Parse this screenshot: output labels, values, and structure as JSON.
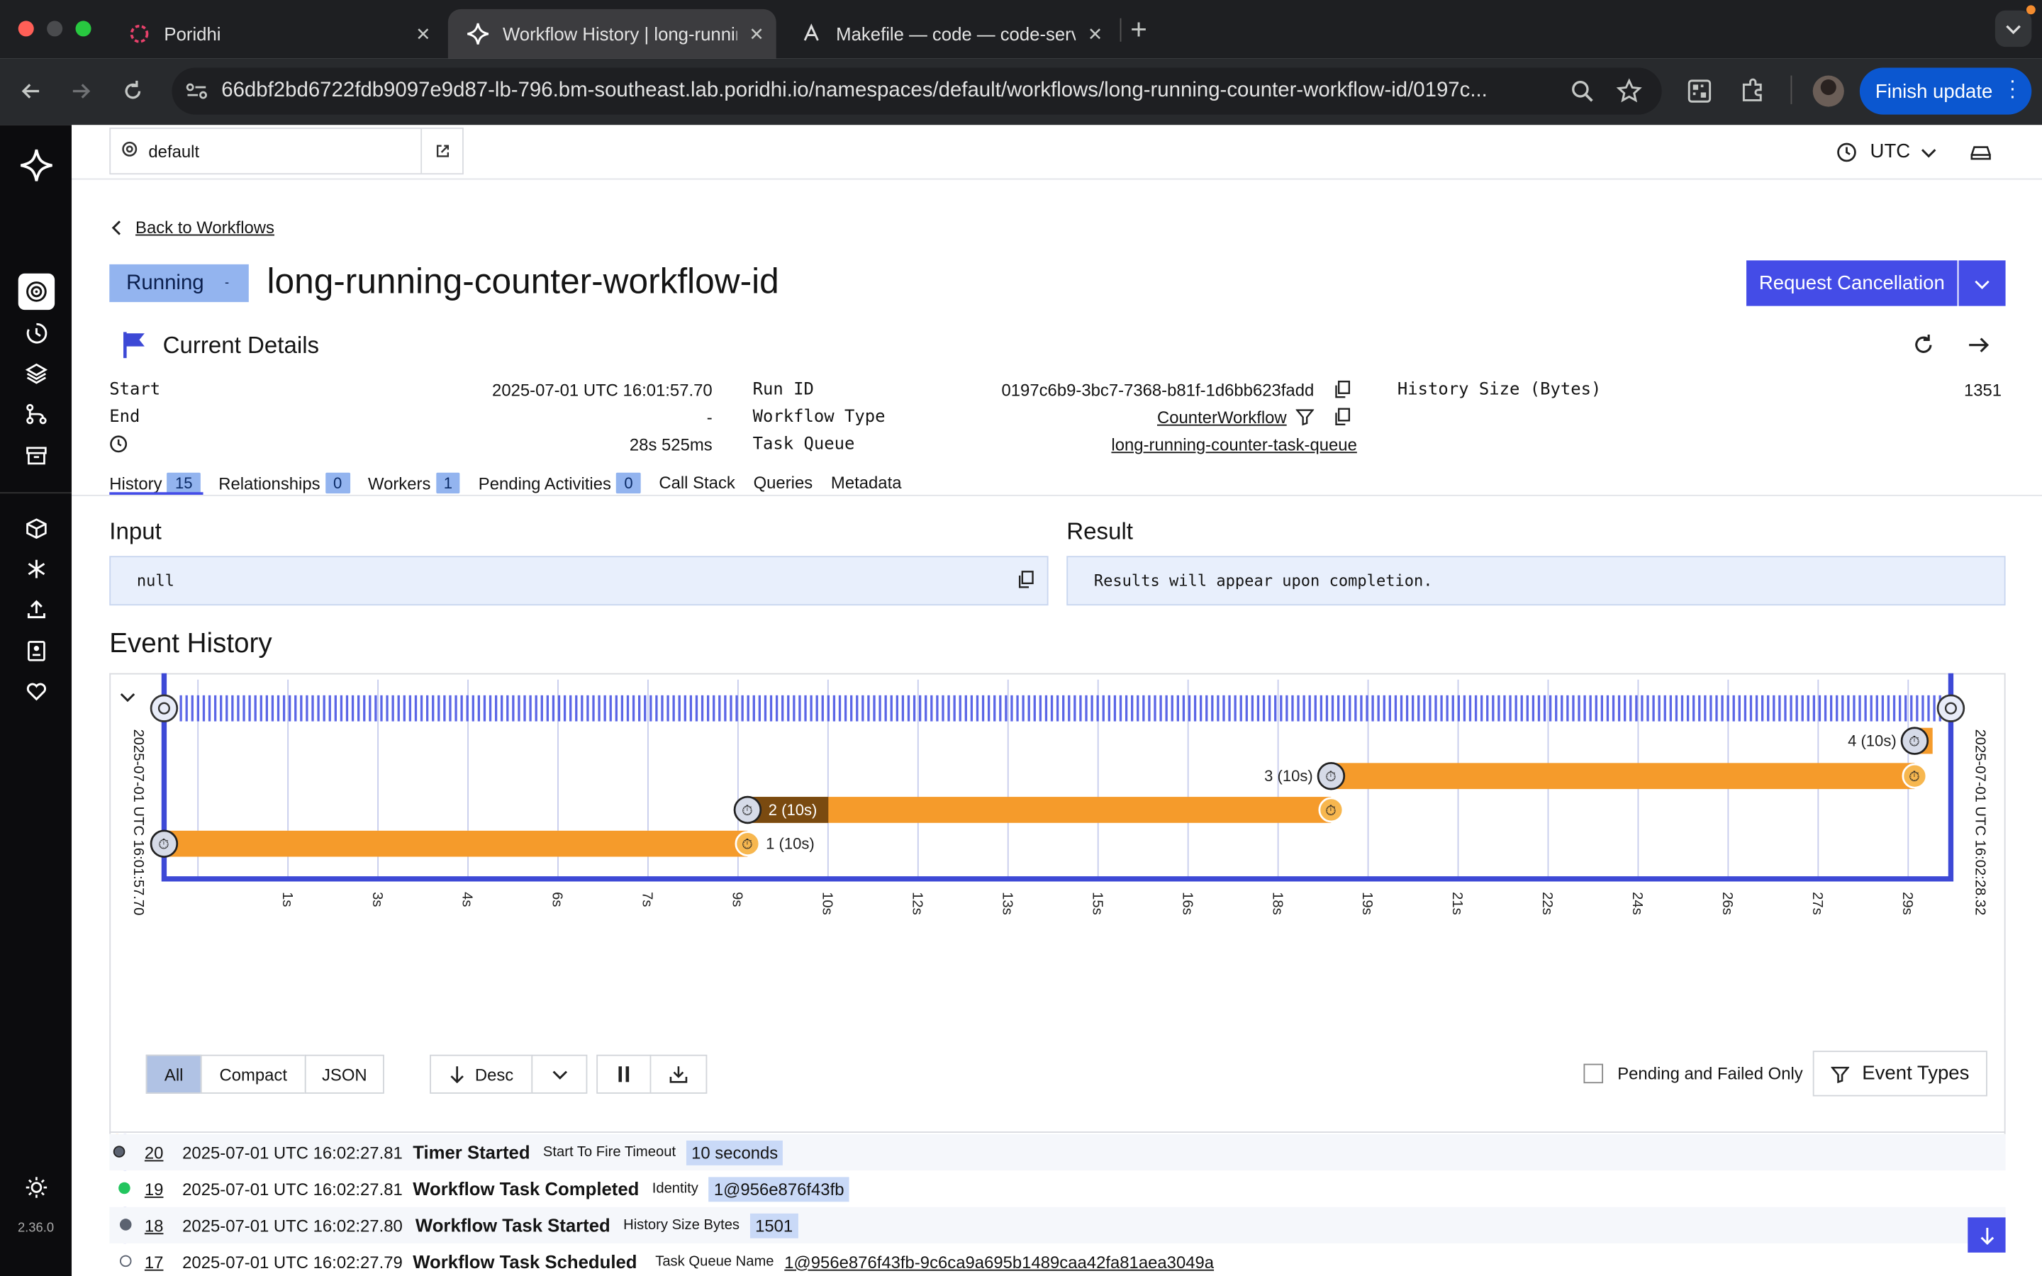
{
  "browser": {
    "tabs": [
      {
        "title": "Poridhi",
        "icon": "poridhi-icon"
      },
      {
        "title": "Workflow History | long-running-counter-workflow-id",
        "icon": "temporal-icon",
        "active": true
      },
      {
        "title": "Makefile — code — code-server",
        "icon": "code-server-icon"
      }
    ],
    "url": "66dbf2bd6722fdb9097e9d87-lb-796.bm-southeast.lab.poridhi.io/namespaces/default/workflows/long-running-counter-workflow-id/0197c...",
    "finish_update_label": "Finish update"
  },
  "sidebar": {
    "version": "2.36.0"
  },
  "header": {
    "namespace": "default",
    "timezone": "UTC"
  },
  "page": {
    "back_label": "Back to Workflows",
    "status": "Running",
    "workflow_id": "long-running-counter-workflow-id",
    "cancel_label": "Request Cancellation",
    "current_details_label": "Current Details"
  },
  "details": {
    "start_label": "Start",
    "start_value": "2025-07-01 UTC 16:01:57.70",
    "end_label": "End",
    "end_value": "-",
    "duration_value": "28s 525ms",
    "run_id_label": "Run ID",
    "run_id_value": "0197c6b9-3bc7-7368-b81f-1d6bb623fadd",
    "workflow_type_label": "Workflow Type",
    "workflow_type_value": "CounterWorkflow",
    "task_queue_label": "Task Queue",
    "task_queue_value": "long-running-counter-task-queue",
    "history_size_label": "History Size (Bytes)",
    "history_size_value": "1351"
  },
  "tabs": [
    {
      "label": "History",
      "count": "15"
    },
    {
      "label": "Relationships",
      "count": "0"
    },
    {
      "label": "Workers",
      "count": "1"
    },
    {
      "label": "Pending Activities",
      "count": "0"
    },
    {
      "label": "Call Stack"
    },
    {
      "label": "Queries"
    },
    {
      "label": "Metadata"
    }
  ],
  "io": {
    "input_label": "Input",
    "input_value": "null",
    "result_label": "Result",
    "result_value": "Results will appear upon completion."
  },
  "event_history": {
    "title": "Event History",
    "start_time": "2025-07-01 UTC 16:01:57.70",
    "end_time": "2025-07-01 UTC 16:02:28.32",
    "ticks": [
      "1s",
      "3s",
      "4s",
      "6s",
      "7s",
      "9s",
      "10s",
      "12s",
      "13s",
      "15s",
      "16s",
      "18s",
      "19s",
      "21s",
      "22s",
      "24s",
      "26s",
      "27s",
      "29s"
    ],
    "timers": [
      {
        "label": "1 (10s)",
        "start_s": 0.0,
        "end_s": 10.0
      },
      {
        "label": "2 (10s)",
        "start_s": 10.0,
        "end_s": 20.0
      },
      {
        "label": "3 (10s)",
        "start_s": 20.0,
        "end_s": 30.0
      },
      {
        "label": "4 (10s)",
        "start_s": 30.0,
        "end_s": 30.6
      }
    ]
  },
  "controls": {
    "view_all": "All",
    "view_compact": "Compact",
    "view_json": "JSON",
    "sort_label": "Desc",
    "pending_failed_label": "Pending and Failed Only",
    "event_types_label": "Event Types"
  },
  "events": [
    {
      "id": "20",
      "time": "2025-07-01 UTC 16:02:27.81",
      "type": "Timer Started",
      "attr_label": "Start To Fire Timeout",
      "attr_value": "10 seconds",
      "attr_style": "tag"
    },
    {
      "id": "19",
      "time": "2025-07-01 UTC 16:02:27.81",
      "type": "Workflow Task Completed",
      "attr_label": "Identity",
      "attr_value": "1@956e876f43fb",
      "attr_style": "tag"
    },
    {
      "id": "18",
      "time": "2025-07-01 UTC 16:02:27.80",
      "type": "Workflow Task Started",
      "attr_label": "History Size Bytes",
      "attr_value": "1501",
      "attr_style": "tag"
    },
    {
      "id": "17",
      "time": "2025-07-01 UTC 16:02:27.79",
      "type": "Workflow Task Scheduled",
      "attr_label": "Task Queue Name",
      "attr_value": "1@956e876f43fb-9c6ca9a695b1489caa42fa81aea3049a",
      "attr_style": "link"
    }
  ]
}
